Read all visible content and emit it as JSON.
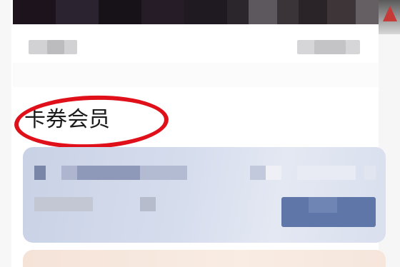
{
  "section": {
    "title": "卡券会员"
  },
  "colors": {
    "highlight_ring": "#e0101a",
    "card_background": "#d6dded",
    "page_background": "#ffffff"
  },
  "icons": {
    "top_thumbnail": "image-thumbnail-icon"
  }
}
